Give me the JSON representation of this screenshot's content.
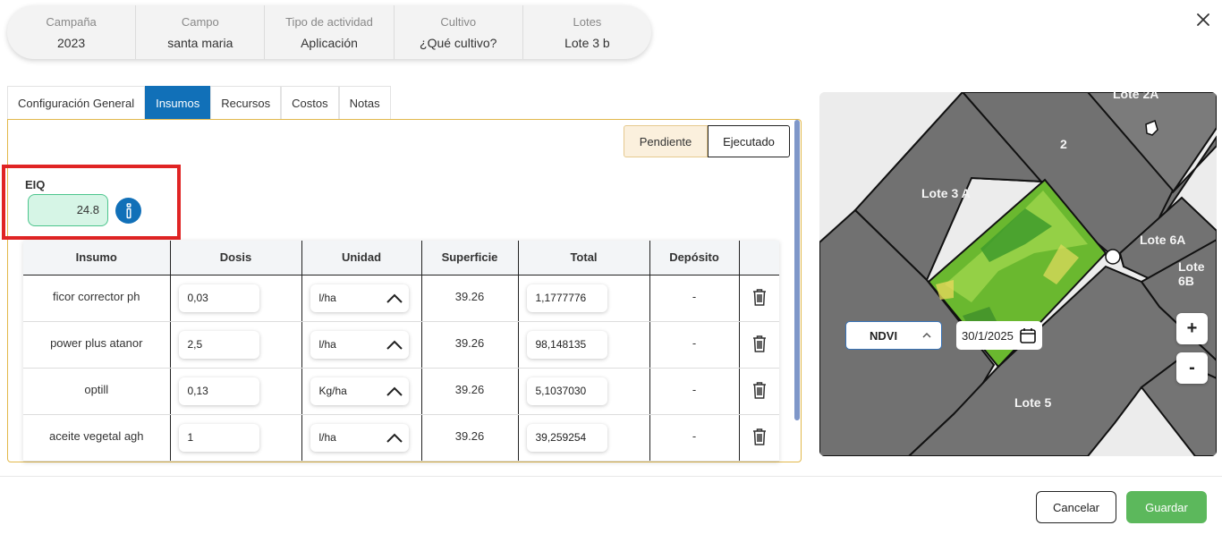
{
  "summary": [
    {
      "label": "Campaña",
      "value": "2023"
    },
    {
      "label": "Campo",
      "value": "santa maria"
    },
    {
      "label": "Tipo de actividad",
      "value": "Aplicación"
    },
    {
      "label": "Cultivo",
      "value": "¿Qué cultivo?"
    },
    {
      "label": "Lotes",
      "value": "Lote 3 b"
    }
  ],
  "tabs": [
    "Configuración General",
    "Insumos",
    "Recursos",
    "Costos",
    "Notas"
  ],
  "active_tab": "Insumos",
  "status": {
    "pending": "Pendiente",
    "executed": "Ejecutado"
  },
  "eiq": {
    "label": "EIQ",
    "value": "24.8"
  },
  "table": {
    "headers": [
      "Insumo",
      "Dosis",
      "Unidad",
      "Superficie",
      "Total",
      "Depósito"
    ],
    "rows": [
      {
        "insumo": "ficor corrector ph",
        "dosis": "0,03",
        "unidad": "l/ha",
        "superficie": "39.26",
        "total": "1,1777776",
        "deposito": "-"
      },
      {
        "insumo": "power plus atanor",
        "dosis": "2,5",
        "unidad": "l/ha",
        "superficie": "39.26",
        "total": "98,148135",
        "deposito": "-"
      },
      {
        "insumo": "optill",
        "dosis": "0,13",
        "unidad": "Kg/ha",
        "superficie": "39.26",
        "total": "5,1037030",
        "deposito": "-"
      },
      {
        "insumo": "aceite vegetal agh",
        "dosis": "1",
        "unidad": "l/ha",
        "superficie": "39.26",
        "total": "39,259254",
        "deposito": "-"
      }
    ]
  },
  "map": {
    "labels": [
      "Lote 2A",
      "2",
      "Lote 3 A",
      "Lote 6A",
      "Lote 6B",
      "Lote 5"
    ],
    "layer": "NDVI",
    "date": "30/1/2025",
    "zoom_in": "+",
    "zoom_out": "-"
  },
  "footer": {
    "cancel": "Cancelar",
    "save": "Guardar"
  },
  "colors": {
    "accent": "#1170b8",
    "save": "#5cb85c",
    "highlight": "#e02424",
    "eiq_bg": "#d6f5e6"
  }
}
